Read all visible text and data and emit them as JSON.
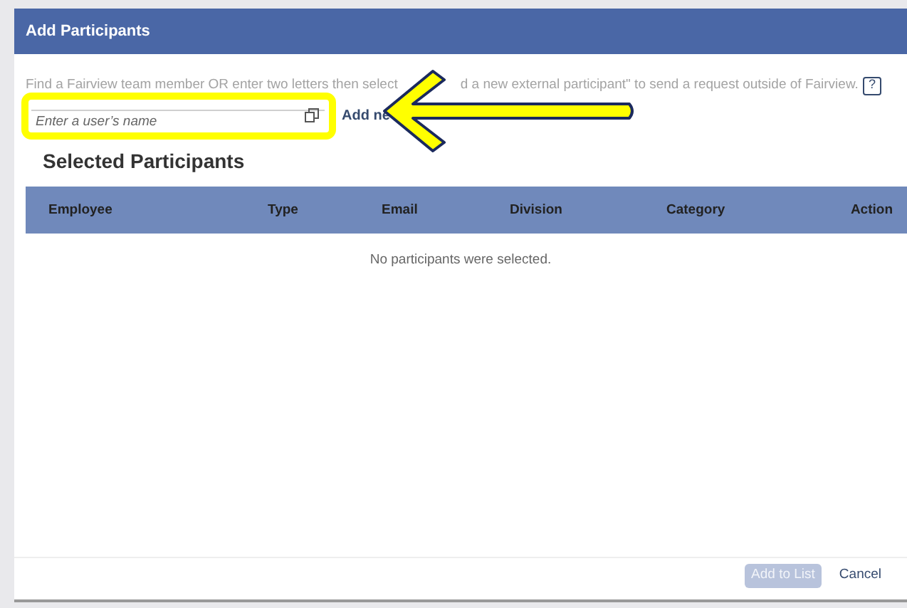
{
  "dialog": {
    "title": "Add Participants"
  },
  "instructions": [
    "Find a Fairview team member OR enter two letters then select",
    "d a new external participant\" to send a request outside of Fairview."
  ],
  "help_icon": "?",
  "search": {
    "placeholder": "Enter a user’s name"
  },
  "add_link": "Add ne",
  "section_title": "Selected Participants",
  "table": {
    "columns": [
      "Employee",
      "Type",
      "Email",
      "Division",
      "Category",
      "Action"
    ],
    "empty_message": "No participants were selected."
  },
  "buttons": [
    {
      "label": "Add to List",
      "kind": "primary",
      "disabled": true
    },
    {
      "label": "Cancel",
      "kind": "text",
      "disabled": false
    }
  ]
}
